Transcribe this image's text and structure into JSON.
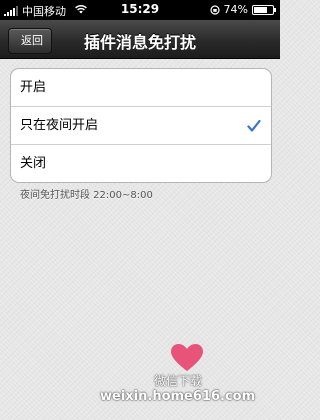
{
  "status_bar": {
    "carrier": "中国移动",
    "time": "15:29",
    "battery_percent": "74%",
    "battery_level": 0.74
  },
  "nav": {
    "back_label": "返回",
    "title": "插件消息免打扰"
  },
  "options": [
    {
      "label": "开启",
      "selected": false
    },
    {
      "label": "只在夜间开启",
      "selected": true
    },
    {
      "label": "关闭",
      "selected": false
    }
  ],
  "hint": "夜间免打扰时段 22:00~8:00",
  "watermark": {
    "line1": "微信下载",
    "line2": "weixin.home616.com",
    "heart_color": "#e8537a"
  },
  "colors": {
    "check": "#3a73d8",
    "navbar": "#2a2a2a"
  }
}
